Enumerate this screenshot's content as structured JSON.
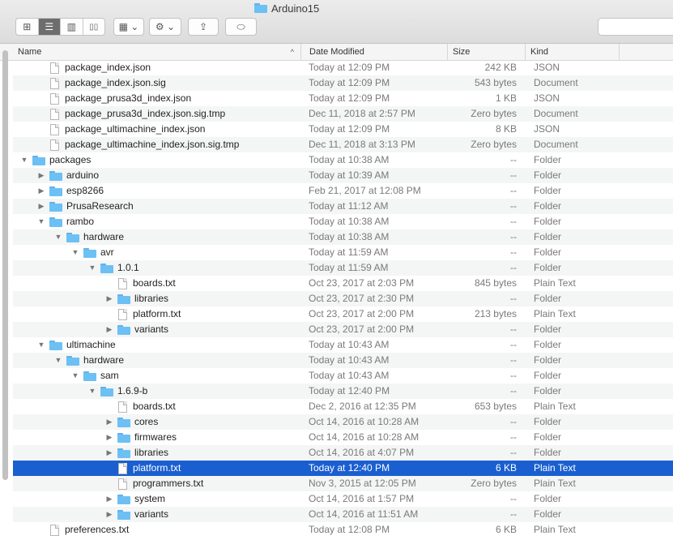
{
  "window": {
    "title": "Arduino15",
    "folder_icon": "folder-icon"
  },
  "toolbar": {
    "view_icons": [
      "icon-view-icon",
      "list-view-icon",
      "column-view-icon",
      "cover-flow-icon"
    ],
    "arrange_icon": "arrange-grid-icon",
    "action_icon": "gear-icon",
    "share_icon": "share-icon",
    "tag_icon": "tag-icon",
    "glyphs": {
      "icon_view": "⊞",
      "list_view": "☰",
      "column_view": "▥",
      "cover_flow": "▯▯",
      "arrange": "▦ ⌄",
      "action": "⚙ ⌄",
      "share": "⇪",
      "tag": "⬭"
    }
  },
  "columns": {
    "name": "Name",
    "date": "Date Modified",
    "size": "Size",
    "kind": "Kind",
    "sort_arrow": "^"
  },
  "selected_color": "#1a5fd0",
  "rows": [
    {
      "name": "package_index.json",
      "date": "Today at 12:09 PM",
      "size": "242 KB",
      "kind": "JSON",
      "type": "file",
      "depth": 1
    },
    {
      "name": "package_index.json.sig",
      "date": "Today at 12:09 PM",
      "size": "543 bytes",
      "kind": "Document",
      "type": "file",
      "depth": 1
    },
    {
      "name": "package_prusa3d_index.json",
      "date": "Today at 12:09 PM",
      "size": "1 KB",
      "kind": "JSON",
      "type": "file",
      "depth": 1
    },
    {
      "name": "package_prusa3d_index.json.sig.tmp",
      "date": "Dec 11, 2018 at 2:57 PM",
      "size": "Zero bytes",
      "kind": "Document",
      "type": "file",
      "depth": 1
    },
    {
      "name": "package_ultimachine_index.json",
      "date": "Today at 12:09 PM",
      "size": "8 KB",
      "kind": "JSON",
      "type": "file",
      "depth": 1
    },
    {
      "name": "package_ultimachine_index.json.sig.tmp",
      "date": "Dec 11, 2018 at 3:13 PM",
      "size": "Zero bytes",
      "kind": "Document",
      "type": "file",
      "depth": 1
    },
    {
      "name": "packages",
      "date": "Today at 10:38 AM",
      "size": "--",
      "kind": "Folder",
      "type": "folder",
      "depth": 0,
      "tri": "▼"
    },
    {
      "name": "arduino",
      "date": "Today at 10:39 AM",
      "size": "--",
      "kind": "Folder",
      "type": "folder",
      "depth": 1,
      "tri": "▶"
    },
    {
      "name": "esp8266",
      "date": "Feb 21, 2017 at 12:08 PM",
      "size": "--",
      "kind": "Folder",
      "type": "folder",
      "depth": 1,
      "tri": "▶"
    },
    {
      "name": "PrusaResearch",
      "date": "Today at 11:12 AM",
      "size": "--",
      "kind": "Folder",
      "type": "folder",
      "depth": 1,
      "tri": "▶"
    },
    {
      "name": "rambo",
      "date": "Today at 10:38 AM",
      "size": "--",
      "kind": "Folder",
      "type": "folder",
      "depth": 1,
      "tri": "▼"
    },
    {
      "name": "hardware",
      "date": "Today at 10:38 AM",
      "size": "--",
      "kind": "Folder",
      "type": "folder",
      "depth": 2,
      "tri": "▼"
    },
    {
      "name": "avr",
      "date": "Today at 11:59 AM",
      "size": "--",
      "kind": "Folder",
      "type": "folder",
      "depth": 3,
      "tri": "▼"
    },
    {
      "name": "1.0.1",
      "date": "Today at 11:59 AM",
      "size": "--",
      "kind": "Folder",
      "type": "folder",
      "depth": 4,
      "tri": "▼"
    },
    {
      "name": "boards.txt",
      "date": "Oct 23, 2017 at 2:03 PM",
      "size": "845 bytes",
      "kind": "Plain Text",
      "type": "file",
      "depth": 5
    },
    {
      "name": "libraries",
      "date": "Oct 23, 2017 at 2:30 PM",
      "size": "--",
      "kind": "Folder",
      "type": "folder",
      "depth": 5,
      "tri": "▶"
    },
    {
      "name": "platform.txt",
      "date": "Oct 23, 2017 at 2:00 PM",
      "size": "213 bytes",
      "kind": "Plain Text",
      "type": "file",
      "depth": 5
    },
    {
      "name": "variants",
      "date": "Oct 23, 2017 at 2:00 PM",
      "size": "--",
      "kind": "Folder",
      "type": "folder",
      "depth": 5,
      "tri": "▶"
    },
    {
      "name": "ultimachine",
      "date": "Today at 10:43 AM",
      "size": "--",
      "kind": "Folder",
      "type": "folder",
      "depth": 1,
      "tri": "▼"
    },
    {
      "name": "hardware",
      "date": "Today at 10:43 AM",
      "size": "--",
      "kind": "Folder",
      "type": "folder",
      "depth": 2,
      "tri": "▼"
    },
    {
      "name": "sam",
      "date": "Today at 10:43 AM",
      "size": "--",
      "kind": "Folder",
      "type": "folder",
      "depth": 3,
      "tri": "▼"
    },
    {
      "name": "1.6.9-b",
      "date": "Today at 12:40 PM",
      "size": "--",
      "kind": "Folder",
      "type": "folder",
      "depth": 4,
      "tri": "▼"
    },
    {
      "name": "boards.txt",
      "date": "Dec 2, 2016 at 12:35 PM",
      "size": "653 bytes",
      "kind": "Plain Text",
      "type": "file",
      "depth": 5
    },
    {
      "name": "cores",
      "date": "Oct 14, 2016 at 10:28 AM",
      "size": "--",
      "kind": "Folder",
      "type": "folder",
      "depth": 5,
      "tri": "▶"
    },
    {
      "name": "firmwares",
      "date": "Oct 14, 2016 at 10:28 AM",
      "size": "--",
      "kind": "Folder",
      "type": "folder",
      "depth": 5,
      "tri": "▶"
    },
    {
      "name": "libraries",
      "date": "Oct 14, 2016 at 4:07 PM",
      "size": "--",
      "kind": "Folder",
      "type": "folder",
      "depth": 5,
      "tri": "▶"
    },
    {
      "name": "platform.txt",
      "date": "Today at 12:40 PM",
      "size": "6 KB",
      "kind": "Plain Text",
      "type": "file",
      "depth": 5,
      "selected": true
    },
    {
      "name": "programmers.txt",
      "date": "Nov 3, 2015 at 12:05 PM",
      "size": "Zero bytes",
      "kind": "Plain Text",
      "type": "file",
      "depth": 5
    },
    {
      "name": "system",
      "date": "Oct 14, 2016 at 1:57 PM",
      "size": "--",
      "kind": "Folder",
      "type": "folder",
      "depth": 5,
      "tri": "▶"
    },
    {
      "name": "variants",
      "date": "Oct 14, 2016 at 11:51 AM",
      "size": "--",
      "kind": "Folder",
      "type": "folder",
      "depth": 5,
      "tri": "▶"
    },
    {
      "name": "preferences.txt",
      "date": "Today at 12:08 PM",
      "size": "6 KB",
      "kind": "Plain Text",
      "type": "file",
      "depth": 1
    }
  ]
}
